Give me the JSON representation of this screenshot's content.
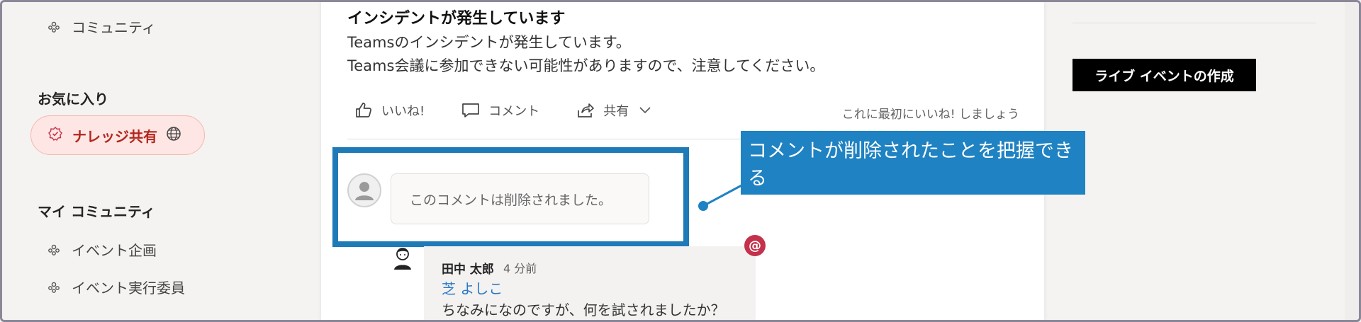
{
  "sidebar": {
    "community_top": "コミュニティ",
    "favorites_heading": "お気に入り",
    "favorite_active": "ナレッジ共有",
    "my_communities_heading": "マイ コミュニティ",
    "communities": [
      "イベント企画",
      "イベント実行委員"
    ]
  },
  "post": {
    "title": "インシデントが発生しています",
    "lines": [
      "Teamsのインシデントが発生しています。",
      "Teams会議に参加できない可能性がありますので、注意してください。"
    ],
    "actions": {
      "like": "いいね!",
      "comment": "コメント",
      "share": "共有"
    },
    "first_like_prompt": "これに最初にいいね! しましょう"
  },
  "deleted_comment": "このコメントは削除されました。",
  "callout": "コメントが削除されたことを把握できる",
  "reply": {
    "author": "田中 太郎",
    "time": "4 分前",
    "mention": "芝 よしこ",
    "text": "ちなみになのですが、何を試されましたか？"
  },
  "right": {
    "live_event_button": "ライブ イベントの作成"
  },
  "colors": {
    "accent_blue": "#1f82c2",
    "favorite_red": "#b3261e",
    "mention_blue": "#2b79c6",
    "at_badge": "#c4314b"
  }
}
